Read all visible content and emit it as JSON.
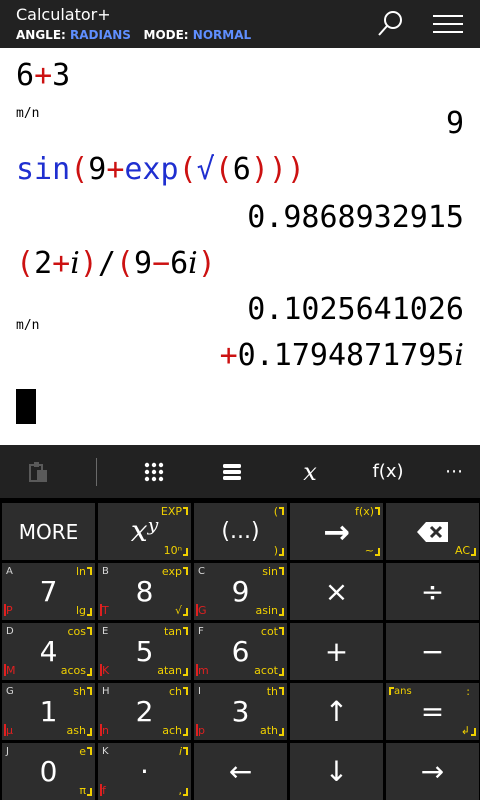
{
  "header": {
    "title": "Calculator+",
    "angle_label": "ANGLE:",
    "angle_value": "RADIANS",
    "mode_label": "MODE:",
    "mode_value": "NORMAL",
    "accent_color": "#5f8fff",
    "icons": [
      "search-icon",
      "hamburger-menu-icon"
    ]
  },
  "display": {
    "entry1": {
      "a": "6",
      "op": "+",
      "b": "3",
      "tag": "m/n",
      "result": "9"
    },
    "entry2": {
      "fn": "sin",
      "p1": "(",
      "n1": "9",
      "op": "+",
      "fn2": "exp",
      "p2": "(",
      "root": "√",
      "p3": "(",
      "n2": "6",
      "close": ")))",
      "result": "0.9868932915"
    },
    "entry3": {
      "p1": "(",
      "n1": "2",
      "op1": "+",
      "i1": "i",
      "p2": ")",
      "slash": "/",
      "p3": "(",
      "n2": "9",
      "op2": "−",
      "n3": "6",
      "i2": "i",
      "p4": ")",
      "tag": "m/n",
      "result_re": "0.1025641026",
      "result_sign": "+",
      "result_im": "0.1794871795",
      "result_i": "i"
    }
  },
  "toolbar": {
    "items": [
      "clipboard-icon",
      "keypad-grid-icon",
      "list-icon",
      "variable-x",
      "function-fx",
      "more-dots"
    ],
    "x_label": "x",
    "fx_label": "f(x)",
    "more_label": "⋯"
  },
  "keys": {
    "more": "MORE",
    "power": {
      "label": "xʸ",
      "tr": "EXP",
      "br": "10ⁿ"
    },
    "paren": {
      "label": "(...)",
      "tr": "(",
      "br": ")"
    },
    "store": {
      "label": "→",
      "tr": "f(x)",
      "br": "~"
    },
    "backspace": {
      "br": "AC"
    },
    "k7": {
      "label": "7",
      "tl": "A",
      "tr": "ln",
      "br": "lg",
      "bl": "P"
    },
    "k8": {
      "label": "8",
      "tl": "B",
      "tr": "exp",
      "br": "√",
      "bl": "T"
    },
    "k9": {
      "label": "9",
      "tl": "C",
      "tr": "sin",
      "br": "asin",
      "bl": "G"
    },
    "mul": "×",
    "div": "÷",
    "k4": {
      "label": "4",
      "tl": "D",
      "tr": "cos",
      "br": "acos",
      "bl": "M"
    },
    "k5": {
      "label": "5",
      "tl": "E",
      "tr": "tan",
      "br": "atan",
      "bl": "K"
    },
    "k6": {
      "label": "6",
      "tl": "F",
      "tr": "cot",
      "br": "acot",
      "bl": "m"
    },
    "plus": "+",
    "minus": "−",
    "k1": {
      "label": "1",
      "tl": "G",
      "tr": "sh",
      "br": "ash",
      "bl": "μ"
    },
    "k2": {
      "label": "2",
      "tl": "H",
      "tr": "ch",
      "br": "ach",
      "bl": "n"
    },
    "k3": {
      "label": "3",
      "tl": "I",
      "tr": "th",
      "br": "ath",
      "bl": "p"
    },
    "up": "↑",
    "ans": {
      "label": "=",
      "tl": "ans",
      "tr": ":",
      "br": "↲"
    },
    "k0": {
      "label": "0",
      "tl": "J",
      "tr": "e",
      "br": "π"
    },
    "dot": {
      "label": "·",
      "tl": "K",
      "tr": "i",
      "br": ",",
      "bl": "f"
    },
    "left": "←",
    "down": "↓",
    "right": "→"
  }
}
